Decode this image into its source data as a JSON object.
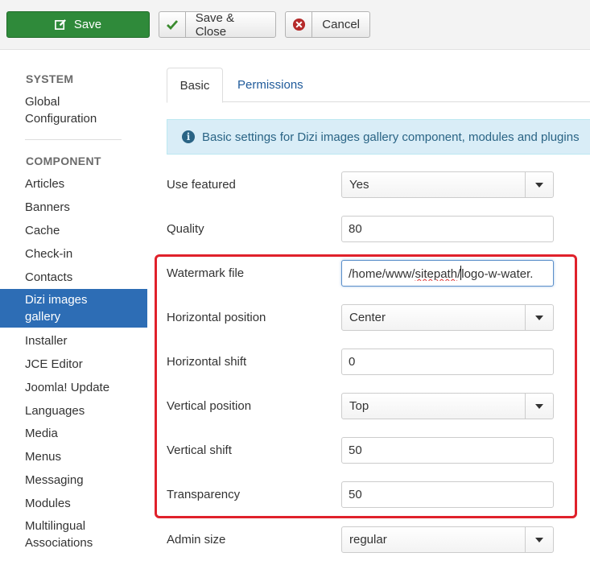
{
  "toolbar": {
    "save": "Save",
    "save_close": "Save & Close",
    "cancel": "Cancel"
  },
  "sidebar": {
    "system_heading": "SYSTEM",
    "global_config_line1": "Global",
    "global_config_line2": "Configuration",
    "component_heading": "COMPONENT",
    "items": [
      "Articles",
      "Banners",
      "Cache",
      "Check-in",
      "Contacts",
      "Dizi images gallery",
      "Installer",
      "JCE Editor",
      "Joomla! Update",
      "Languages",
      "Media",
      "Menus",
      "Messaging",
      "Modules",
      "Multilingual Associations"
    ],
    "active_line1": "Dizi images",
    "active_line2": "gallery",
    "multi_line1": "Multilingual",
    "multi_line2": "Associations"
  },
  "tabs": {
    "basic": "Basic",
    "permissions": "Permissions"
  },
  "alert": {
    "text": "Basic settings for Dizi images gallery component, modules and plugins"
  },
  "fields": {
    "use_featured": {
      "label": "Use featured",
      "value": "Yes"
    },
    "quality": {
      "label": "Quality",
      "value": "80"
    },
    "watermark_file": {
      "label": "Watermark file",
      "value_prefix": "/home/www/",
      "value_spell": "sitepath",
      "value_mid": "/",
      "value_suffix": "logo-w-water."
    },
    "horizontal_position": {
      "label": "Horizontal position",
      "value": "Center"
    },
    "horizontal_shift": {
      "label": "Horizontal shift",
      "value": "0"
    },
    "vertical_position": {
      "label": "Vertical position",
      "value": "Top"
    },
    "vertical_shift": {
      "label": "Vertical shift",
      "value": "50"
    },
    "transparency": {
      "label": "Transparency",
      "value": "50"
    },
    "admin_size": {
      "label": "Admin size",
      "value": "regular"
    }
  },
  "colors": {
    "save_green": "#2f8a3a",
    "active_blue": "#2d6db5",
    "highlight_red": "#e0212b"
  },
  "icons": {
    "save": "edit-icon",
    "save_close": "check-icon",
    "cancel": "cancel-circle-icon",
    "alert": "info-icon"
  }
}
